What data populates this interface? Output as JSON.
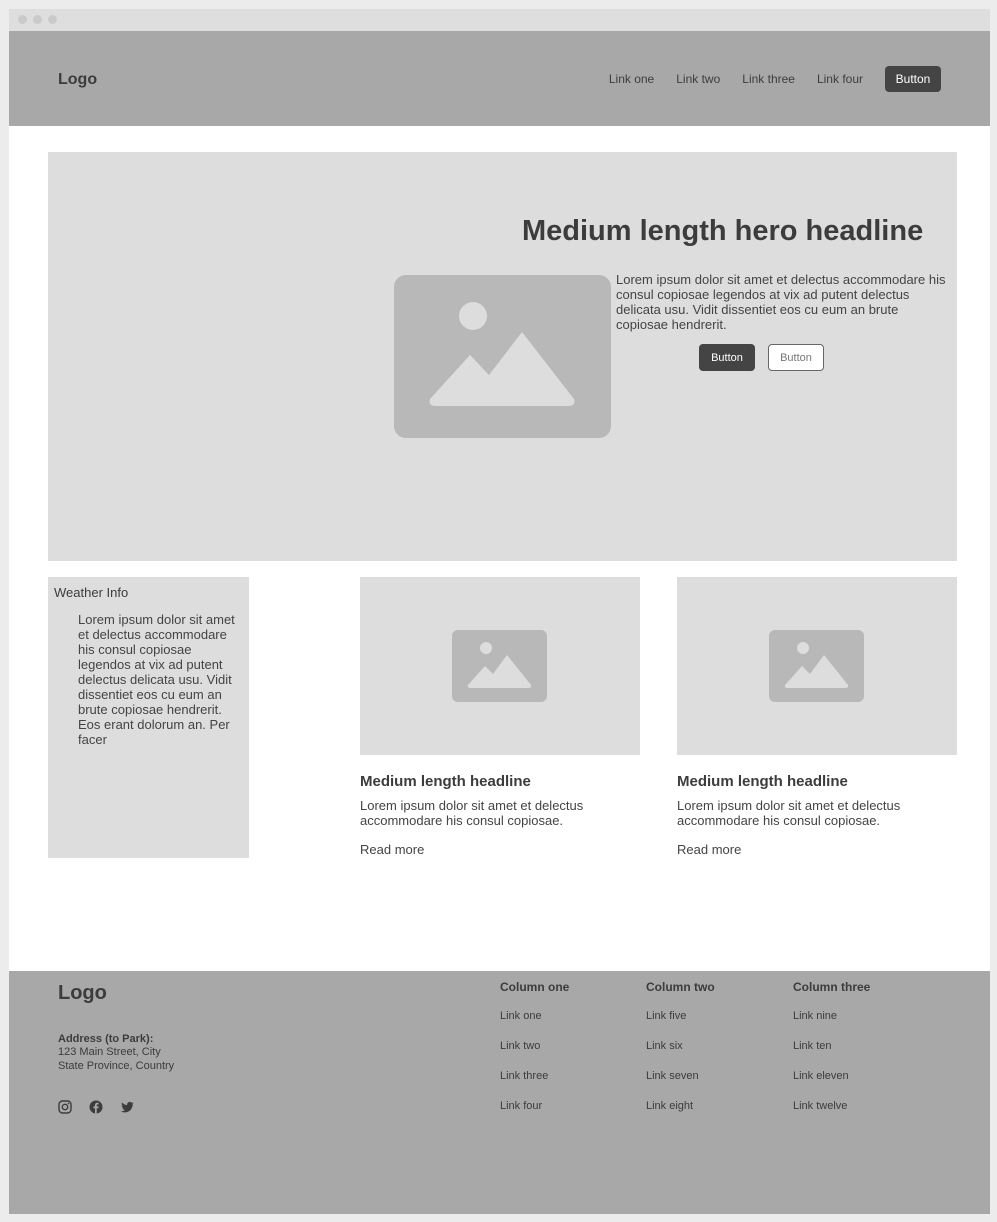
{
  "nav": {
    "logo": "Logo",
    "links": [
      "Link one",
      "Link two",
      "Link three",
      "Link four"
    ],
    "button": "Button"
  },
  "hero": {
    "headline": "Medium length hero headline",
    "body": "Lorem ipsum dolor sit amet et delectus accommodare his consul copiosae legendos at vix ad putent delectus delicata usu. Vidit dissentiet eos cu eum an brute copiosae hendrerit.",
    "primary_button": "Button",
    "secondary_button": "Button"
  },
  "weather": {
    "title": "Weather Info",
    "text": "Lorem ipsum dolor sit amet et delectus accommodare his consul copiosae legendos at vix ad putent delectus delicata usu. Vidit dissentiet eos cu eum an brute copiosae hendrerit. Eos erant dolorum an. Per facer"
  },
  "cards": [
    {
      "headline": "Medium length headline",
      "text": "Lorem ipsum dolor sit amet et delectus accommodare his consul copiosae.",
      "link": "Read more"
    },
    {
      "headline": "Medium length headline",
      "text": "Lorem ipsum dolor sit amet et delectus accommodare his consul copiosae.",
      "link": "Read more"
    }
  ],
  "footer": {
    "logo": "Logo",
    "address_label": "Address (to Park):",
    "address_line1": "123 Main Street, City",
    "address_line2": "State Province, Country",
    "social_icons": [
      "instagram-icon",
      "facebook-icon",
      "twitter-icon"
    ],
    "columns": [
      {
        "title": "Column one",
        "links": [
          "Link one",
          "Link two",
          "Link three",
          "Link four"
        ]
      },
      {
        "title": "Column two",
        "links": [
          "Link five",
          "Link six",
          "Link seven",
          "Link eight"
        ]
      },
      {
        "title": "Column three",
        "links": [
          "Link nine",
          "Link ten",
          "Link eleven",
          "Link twelve"
        ]
      }
    ]
  },
  "colors": {
    "page_bg": "#ececec",
    "nav_bg": "#a8a8a8",
    "placeholder_bg": "#dddddd",
    "image_fill": "#b8b8b8",
    "button_dark": "#444444"
  }
}
